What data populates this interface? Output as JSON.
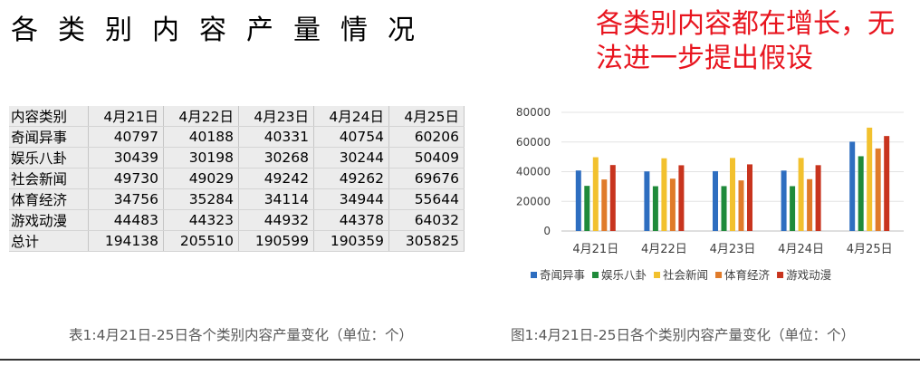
{
  "slide": {
    "title": "各类别内容产量情况",
    "conclusion": "各类别内容都在增长，无法进一步提出假设"
  },
  "table": {
    "corner": "内容类别",
    "columns": [
      "4月21日",
      "4月22日",
      "4月23日",
      "4月24日",
      "4月25日"
    ],
    "rows": [
      {
        "label": "奇闻异事",
        "values": [
          "40797",
          "40188",
          "40331",
          "40754",
          "60206"
        ]
      },
      {
        "label": "娱乐八卦",
        "values": [
          "30439",
          "30198",
          "30268",
          "30244",
          "50409"
        ]
      },
      {
        "label": "社会新闻",
        "values": [
          "49730",
          "49029",
          "49242",
          "49262",
          "69676"
        ]
      },
      {
        "label": "体育经济",
        "values": [
          "34756",
          "35284",
          "34114",
          "34944",
          "55644"
        ]
      },
      {
        "label": "游戏动漫",
        "values": [
          "44483",
          "44323",
          "44932",
          "44378",
          "64032"
        ]
      },
      {
        "label": "总计",
        "values": [
          "194138",
          "205510",
          "190599",
          "190359",
          "305825"
        ]
      }
    ],
    "caption": "表1:4月21日-25日各个类别内容产量变化（单位：个）"
  },
  "chart_caption": "图1:4月21日-25日各个类别内容产量变化（单位：个）",
  "chart_data": {
    "type": "bar",
    "categories": [
      "4月21日",
      "4月22日",
      "4月23日",
      "4月24日",
      "4月25日"
    ],
    "series": [
      {
        "name": "奇闻异事",
        "color": "#2e6ec0",
        "values": [
          40797,
          40188,
          40331,
          40754,
          60206
        ]
      },
      {
        "name": "娱乐八卦",
        "color": "#1f8a3a",
        "values": [
          30439,
          30198,
          30268,
          30244,
          50409
        ]
      },
      {
        "name": "社会新闻",
        "color": "#f2c12e",
        "values": [
          49730,
          49029,
          49242,
          49262,
          69676
        ]
      },
      {
        "name": "体育经济",
        "color": "#e07b2a",
        "values": [
          34756,
          35284,
          34114,
          34944,
          55644
        ]
      },
      {
        "name": "游戏动漫",
        "color": "#c8341e",
        "values": [
          44483,
          44323,
          44932,
          44378,
          64032
        ]
      }
    ],
    "yticks": [
      "0",
      "20000",
      "40000",
      "60000",
      "80000"
    ],
    "ylim": [
      0,
      80000
    ],
    "grid": true,
    "legend": "bottom"
  }
}
